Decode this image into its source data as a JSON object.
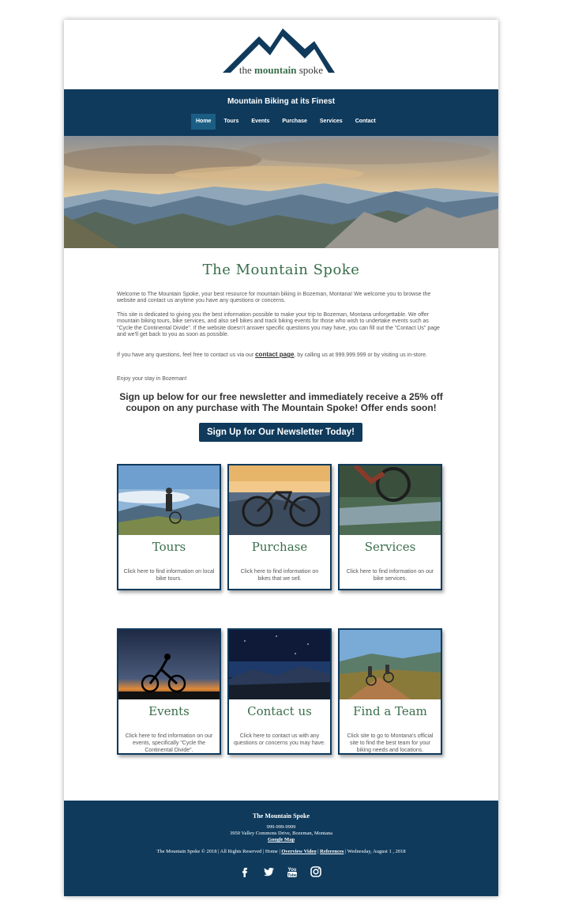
{
  "logo": {
    "prefix": "the ",
    "bold": "mountain",
    "suffix": " spoke"
  },
  "header": {
    "tagline": "Mountain Biking at its Finest"
  },
  "nav": {
    "items": [
      {
        "label": "Home",
        "active": true
      },
      {
        "label": "Tours"
      },
      {
        "label": "Events"
      },
      {
        "label": "Purchase"
      },
      {
        "label": "Services"
      },
      {
        "label": "Contact"
      }
    ]
  },
  "main": {
    "title": "The Mountain Spoke",
    "intro": "Welcome to The Mountain Spoke, your best resource for mountain biking in Bozeman, Montana! We welcome you to browse the website and contact us anytime you have any questions or concerns.",
    "about": "This site is dedicated to giving you the best information possible to make your trip to Bozeman, Montana unforgettable. We offer mountain biking tours, bike services, and also sell bikes and track biking events for those who wish to undertake events such as \"Cycle the Continental Divide\". If the website doesn't answer specific questions you may have, you can fill out the \"Contact Us\" page and we'll get back to you as soon as possible.",
    "contact_pre": "If you have any questions, feel free to contact us via our ",
    "contact_link": "contact page",
    "contact_post": ", by calling us at 999.999.999 or by visiting us in-store.",
    "enjoy": "Enjoy your stay in Bozeman!",
    "promo": "Sign up below for our free newsletter and immediately receive a 25% off coupon on any purchase with The Mountain Spoke! Offer ends soon!",
    "cta": "Sign Up for Our Newsletter Today!"
  },
  "cards": [
    {
      "title": "Tours",
      "text": "Click here to find information on local bike tours."
    },
    {
      "title": "Purchase",
      "text": "Click here to find information on bikes that we sell."
    },
    {
      "title": "Services",
      "text": "Click here to find information on our bike services."
    },
    {
      "title": "Events",
      "text": "Click here to find information on our events, specifically \"Cycle the Continental Divide\"."
    },
    {
      "title": "Contact us",
      "text": "Click here to contact us with any questions or concerns you may have."
    },
    {
      "title": "Find a Team",
      "text": "Click site to go to Montana's official site to find the best team for your biking needs and locations."
    }
  ],
  "footer": {
    "title": "The Mountain Spoke",
    "phone": "999-999-9999",
    "address": "3950 Valley Commons Drive, Bozeman, Montana",
    "map": "Google Map",
    "copyright": "The Mountain Spoke © 2018 | All Rights Reserved | ",
    "home": "Home",
    "sep": " | ",
    "video": "Overview Video",
    "references": "References",
    "date": " | Wednesday, August 1 , 2018",
    "social_icons": [
      "facebook-icon",
      "twitter-icon",
      "youtube-icon",
      "instagram-icon"
    ]
  },
  "colors": {
    "navy": "#0f3a5c",
    "accent_green": "#3a6e4b",
    "active_nav": "#1b5e84"
  }
}
